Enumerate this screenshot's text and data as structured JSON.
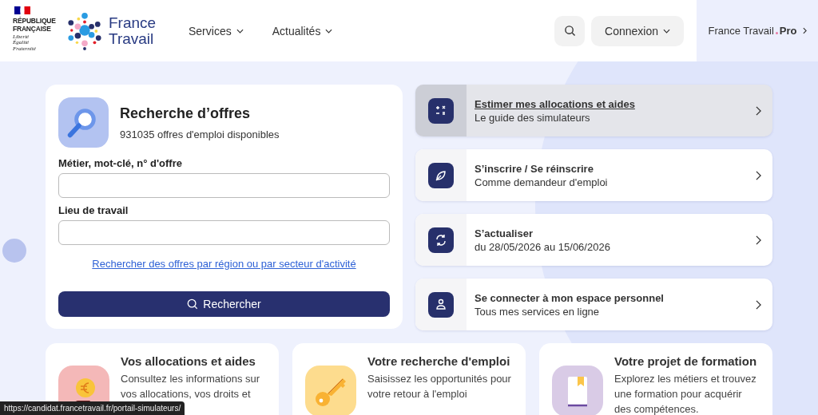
{
  "header": {
    "republic": {
      "name": "RÉPUBLIQUE FRANÇAISE",
      "motto": [
        "Liberté",
        "Égalité",
        "Fraternité"
      ]
    },
    "brand": "France Travail",
    "nav": [
      {
        "label": "Services"
      },
      {
        "label": "Actualités"
      }
    ],
    "connexion": "Connexion",
    "pro": {
      "label": "France Travail",
      "suffix": "Pro"
    }
  },
  "search_card": {
    "title": "Recherche d’offres",
    "subtitle": "931035 offres d'emploi disponibles",
    "fields": [
      {
        "label": "Métier, mot-clé, n° d'offre"
      },
      {
        "label": "Lieu de travail"
      }
    ],
    "link": "Rechercher des offres par région ou par secteur d'activité",
    "button": "Rechercher"
  },
  "quick_links": [
    {
      "kind": "calculator",
      "title": "Estimer mes allocations et aides",
      "subtitle": "Le guide des simulateurs",
      "selected": true
    },
    {
      "kind": "leaf",
      "title": "S’inscrire / Se réinscrire",
      "subtitle": "Comme demandeur d'emploi",
      "selected": false
    },
    {
      "kind": "refresh",
      "title": "S’actualiser",
      "subtitle": "du 28/05/2026 au 15/06/2026",
      "selected": false
    },
    {
      "kind": "person",
      "title": "Se connecter à mon espace personnel",
      "subtitle": "Tous mes services en ligne",
      "selected": false
    }
  ],
  "feature_cards": [
    {
      "kind": "allowance",
      "title": "Vos allocations et aides",
      "description": "Consultez les informations sur vos allocations, vos droits et"
    },
    {
      "kind": "key",
      "title": "Votre recherche d'emploi",
      "description": "Saisissez les opportunités pour votre retour à l'emploi"
    },
    {
      "kind": "book",
      "title": "Votre projet de formation",
      "description": "Explorez les métiers et trouvez une formation pour acquérir des compétences."
    }
  ],
  "status_bar": {
    "url": "https://candidat.francetravail.fr/portail-simulateurs/"
  }
}
